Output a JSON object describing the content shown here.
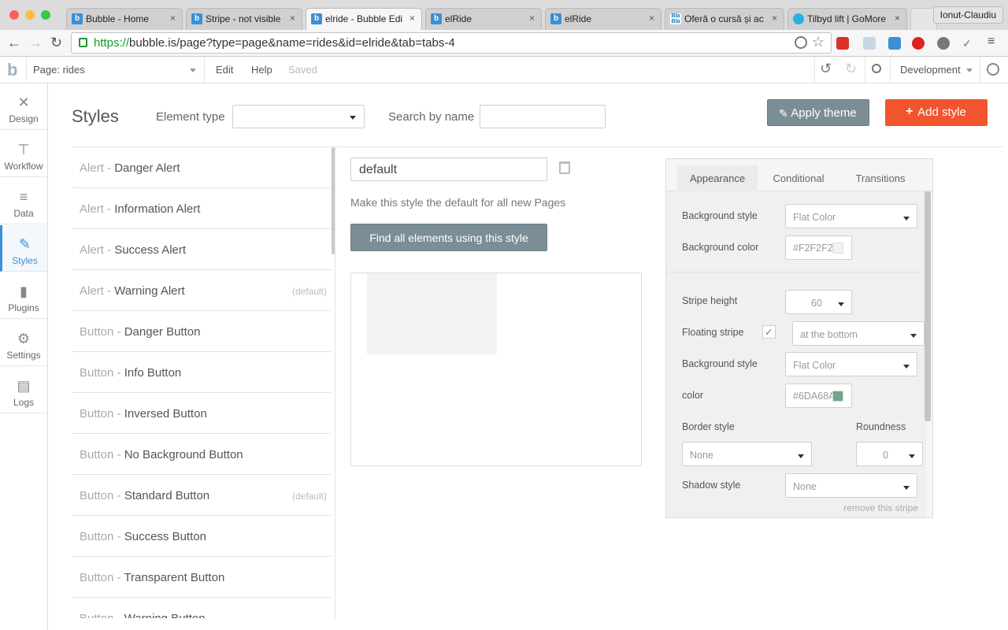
{
  "browser": {
    "tabs": [
      {
        "title": "Bubble - Home",
        "favicon": "bubble-b"
      },
      {
        "title": "Stripe - not visible",
        "favicon": "bubble-b"
      },
      {
        "title": "elride - Bubble Edi",
        "favicon": "bubble-b"
      },
      {
        "title": "elRide",
        "favicon": "bubble-b"
      },
      {
        "title": "elRide",
        "favicon": "bubble-b"
      },
      {
        "title": "Oferă o cursă și ac",
        "favicon": "Bla Bla"
      },
      {
        "title": "Tilbyd lift | GoMore",
        "favicon": "gomore"
      }
    ],
    "profile_name": "Ionut-Claudiu",
    "url_scheme": "https://",
    "url_rest": "bubble.is/page?type=page&name=rides&id=elride&tab=tabs-4",
    "close_glyph": "×"
  },
  "appbar": {
    "page_selector": "Page: rides",
    "menu": [
      "Edit",
      "Help"
    ],
    "saved_status": "Saved",
    "environment": "Development"
  },
  "leftnav": [
    {
      "label": "Design",
      "icon": "design-icon"
    },
    {
      "label": "Workflow",
      "icon": "workflow-icon"
    },
    {
      "label": "Data",
      "icon": "data-icon"
    },
    {
      "label": "Styles",
      "icon": "styles-icon",
      "active": true
    },
    {
      "label": "Plugins",
      "icon": "plugins-icon"
    },
    {
      "label": "Settings",
      "icon": "settings-icon"
    },
    {
      "label": "Logs",
      "icon": "logs-icon"
    }
  ],
  "header": {
    "title": "Styles",
    "element_type_label": "Element type",
    "element_type_value": "",
    "search_label": "Search by name",
    "search_value": "",
    "apply_theme": "Apply theme",
    "add_style": "Add style"
  },
  "styles": [
    {
      "category": "Alert",
      "name": "Danger Alert",
      "default": ""
    },
    {
      "category": "Alert",
      "name": "Information Alert",
      "default": ""
    },
    {
      "category": "Alert",
      "name": "Success Alert",
      "default": ""
    },
    {
      "category": "Alert",
      "name": "Warning Alert",
      "default": "(default)"
    },
    {
      "category": "Button",
      "name": "Danger Button",
      "default": ""
    },
    {
      "category": "Button",
      "name": "Info Button",
      "default": ""
    },
    {
      "category": "Button",
      "name": "Inversed Button",
      "default": ""
    },
    {
      "category": "Button",
      "name": "No Background Button",
      "default": ""
    },
    {
      "category": "Button",
      "name": "Standard Button",
      "default": "(default)"
    },
    {
      "category": "Button",
      "name": "Success Button",
      "default": ""
    },
    {
      "category": "Button",
      "name": "Transparent Button",
      "default": ""
    },
    {
      "category": "Button",
      "name": "Warning Button",
      "default": ""
    }
  ],
  "editor": {
    "style_name": "default",
    "make_default_text": "Make this style the default for all new Pages",
    "find_elements": "Find all elements using this style"
  },
  "props": {
    "tabs": [
      "Appearance",
      "Conditional",
      "Transitions"
    ],
    "background_style_label": "Background style",
    "background_style_value": "Flat Color",
    "background_color_label": "Background color",
    "background_color_value": "#F2F2F2",
    "stripe_height_label": "Stripe height",
    "stripe_height_value": "60",
    "floating_stripe_label": "Floating stripe",
    "floating_stripe_checked": true,
    "floating_position_value": "at the bottom",
    "stripe_bg_style_label": "Background style",
    "stripe_bg_style_value": "Flat Color",
    "color_label": "color",
    "color_value": "#6DA68A",
    "border_style_label": "Border style",
    "border_style_value": "None",
    "roundness_label": "Roundness",
    "roundness_value": "0",
    "shadow_style_label": "Shadow style",
    "shadow_style_value": "None",
    "remove_stripe": "remove this stripe"
  },
  "colors": {
    "accent_blue": "#3D8FD6",
    "apply_theme_bg": "#7B8E96",
    "add_style_bg": "#F2542D",
    "find_btn_bg": "#7B8E96"
  }
}
